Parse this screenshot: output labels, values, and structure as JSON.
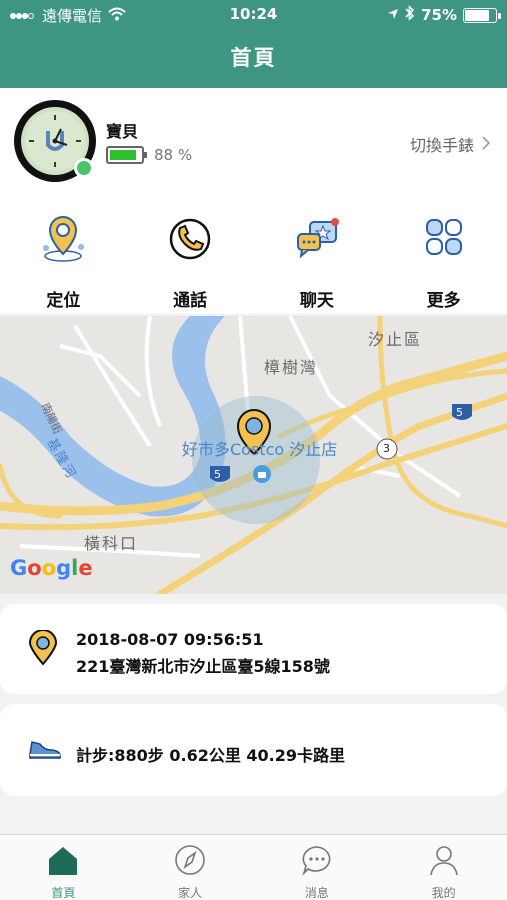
{
  "status_bar": {
    "carrier": "遠傳電信",
    "time": "10:24",
    "battery": "75%"
  },
  "header": {
    "title": "首頁"
  },
  "profile": {
    "name": "寶貝",
    "battery_percent": "88 %",
    "battery_level": 0.88,
    "switch_label": "切換手錶"
  },
  "actions": [
    {
      "label": "定位",
      "icon": "location-icon"
    },
    {
      "label": "通話",
      "icon": "phone-icon"
    },
    {
      "label": "聊天",
      "icon": "chat-icon"
    },
    {
      "label": "更多",
      "icon": "more-grid-icon"
    }
  ],
  "map": {
    "labels": {
      "xizhi": "汐止區",
      "zhangshuwan": "樟樹灣",
      "costco": "好市多Costco 汐止店",
      "hengke": "橫科口",
      "nanyang": "南陽街",
      "keelung_river": "基隆河",
      "route_5a": "5",
      "route_5b": "5",
      "route_3": "3",
      "google": "Google"
    }
  },
  "location": {
    "time": "2018-08-07 09:56:51",
    "address": "221臺灣新北市汐止區臺5線158號"
  },
  "steps": {
    "text": "計步:880步 0.62公里 40.29卡路里"
  },
  "tabs": [
    {
      "label": "首頁",
      "icon": "home-icon",
      "active": true
    },
    {
      "label": "家人",
      "icon": "compass-icon",
      "active": false
    },
    {
      "label": "消息",
      "icon": "message-icon",
      "active": false
    },
    {
      "label": "我的",
      "icon": "user-icon",
      "active": false
    }
  ],
  "colors": {
    "brand": "#3e9682",
    "battery_green": "#2fbf2f",
    "pin_yellow": "#f2c14e",
    "accent_blue": "#2d5fa8"
  }
}
